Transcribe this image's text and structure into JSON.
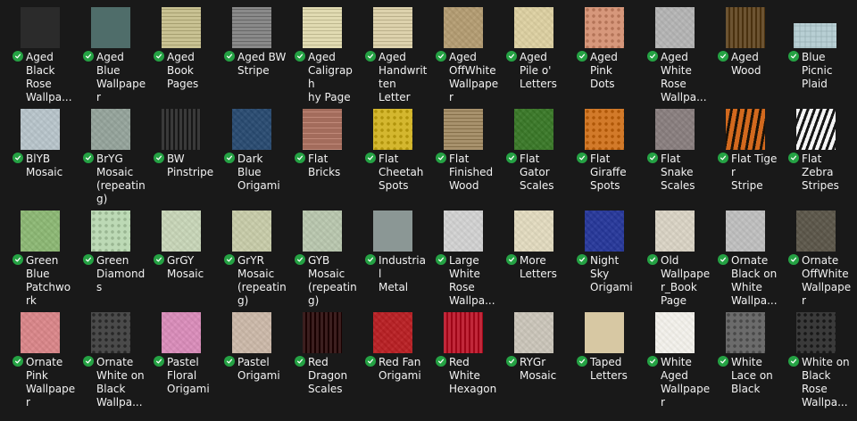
{
  "items": [
    {
      "label": "Aged\nBlack\nRose\nWallpa...",
      "pattern": "dark-grain",
      "color": "#2b2b2b"
    },
    {
      "label": "Aged\nBlue\nWallpape\nr",
      "pattern": "solid",
      "color": "#4f6d6a"
    },
    {
      "label": "Aged\nBook\nPages",
      "pattern": "stripes-h",
      "color": "#c9c293"
    },
    {
      "label": "Aged BW\nStripe",
      "pattern": "stripes-h",
      "color": "#8a8a8a"
    },
    {
      "label": "Aged\nCaligraph\nhy Page",
      "pattern": "stripes-h",
      "color": "#e1dbb2"
    },
    {
      "label": "Aged\nHandwrit\nten\nLetter",
      "pattern": "stripes-h",
      "color": "#ddd2ad"
    },
    {
      "label": "Aged\nOffWhite\nWallpape\nr",
      "pattern": "grain",
      "color": "#b29c74"
    },
    {
      "label": "Aged\nPile o'\nLetters",
      "pattern": "grain",
      "color": "#d9cda1"
    },
    {
      "label": "Aged\nPink\nDots",
      "pattern": "dots",
      "color": "#d6977b"
    },
    {
      "label": "Aged\nWhite\nRose\nWallpa...",
      "pattern": "grain",
      "color": "#b3b3b3"
    },
    {
      "label": "Aged\nWood",
      "pattern": "stripes-v",
      "color": "#6d5432"
    },
    {
      "label": "Blue\nPicnic\nPlaid",
      "pattern": "plaid",
      "color": "#b8cfd4"
    },
    {
      "label": "BlYB\nMosaic",
      "pattern": "grain",
      "color": "#b6c2c8"
    },
    {
      "label": "BrYG\nMosaic\n(repeatin\ng)",
      "pattern": "grain",
      "color": "#95a39b"
    },
    {
      "label": "BW\nPinstripe",
      "pattern": "stripes-v",
      "color": "#3a3a3a"
    },
    {
      "label": "Dark\nBlue\nOrigami",
      "pattern": "grain",
      "color": "#2f4f73"
    },
    {
      "label": "Flat\nBricks",
      "pattern": "bricks",
      "color": "#a36c5c"
    },
    {
      "label": "Flat\nCheetah\nSpots",
      "pattern": "dots",
      "color": "#d4b72f"
    },
    {
      "label": "Flat\nFinished\nWood",
      "pattern": "stripes-h",
      "color": "#a8926d"
    },
    {
      "label": "Flat\nGator\nScales",
      "pattern": "grain",
      "color": "#3f7a2e"
    },
    {
      "label": "Flat\nGiraffe\nSpots",
      "pattern": "dots",
      "color": "#d27a2a"
    },
    {
      "label": "Flat\nSnake\nScales",
      "pattern": "grain",
      "color": "#8a8080"
    },
    {
      "label": "Flat Tiger\nStripe",
      "pattern": "tiger",
      "color": "#d2691e"
    },
    {
      "label": "Flat\nZebra\nStripes",
      "pattern": "zebra",
      "color": "#dcdcdc"
    },
    {
      "label": "Green\nBlue\nPatchwo\nrk",
      "pattern": "grain",
      "color": "#8db676"
    },
    {
      "label": "Green\nDiamonds",
      "pattern": "dots",
      "color": "#bcd9b5"
    },
    {
      "label": "GrGY\nMosaic",
      "pattern": "grain",
      "color": "#c5d2b6"
    },
    {
      "label": "GrYR\nMosaic\n(repeatin\ng)",
      "pattern": "grain",
      "color": "#c5c9a8"
    },
    {
      "label": "GYB\nMosaic\n(repeatin\ng)",
      "pattern": "grain",
      "color": "#b7c4ad"
    },
    {
      "label": "Industrial\nMetal",
      "pattern": "solid",
      "color": "#8b9795"
    },
    {
      "label": "Large\nWhite\nRose\nWallpa...",
      "pattern": "grain",
      "color": "#cfcfcf"
    },
    {
      "label": "More\nLetters",
      "pattern": "grain",
      "color": "#ded7bd"
    },
    {
      "label": "Night\nSky\nOrigami",
      "pattern": "grain",
      "color": "#2d3d9a"
    },
    {
      "label": "Old\nWallpape\nr_Book\nPage",
      "pattern": "grain",
      "color": "#d6d0c2"
    },
    {
      "label": "Ornate\nBlack on\nWhite\nWallpa...",
      "pattern": "grain",
      "color": "#bdbdbd"
    },
    {
      "label": "Ornate\nOffWhite\nWallpape\nr",
      "pattern": "grain",
      "color": "#5f5a4e"
    },
    {
      "label": "Ornate\nPink\nWallpape\nr",
      "pattern": "grain",
      "color": "#d6878a"
    },
    {
      "label": "Ornate\nWhite on\nBlack\nWallpa...",
      "pattern": "dots",
      "color": "#4a4a4a"
    },
    {
      "label": "Pastel\nFloral\nOrigami",
      "pattern": "grain",
      "color": "#d68db8"
    },
    {
      "label": "Pastel\nOrigami",
      "pattern": "grain",
      "color": "#c9b7a8"
    },
    {
      "label": "Red\nDragon\nScales",
      "pattern": "stripes-v",
      "color": "#3c1f1f"
    },
    {
      "label": "Red Fan\nOrigami",
      "pattern": "grain",
      "color": "#b7262a"
    },
    {
      "label": "Red\nWhite\nHexagon",
      "pattern": "stripes-v",
      "color": "#c1283a"
    },
    {
      "label": "RYGr\nMosaic",
      "pattern": "grain",
      "color": "#c8c3b8"
    },
    {
      "label": "Taped\nLetters",
      "pattern": "solid",
      "color": "#d7c8a3"
    },
    {
      "label": "White\nAged\nWallpape\nr",
      "pattern": "grain",
      "color": "#f0eee8"
    },
    {
      "label": "White\nLace on\nBlack",
      "pattern": "dots",
      "color": "#6b6b6b"
    },
    {
      "label": "White on\nBlack\nRose\nWallpa...",
      "pattern": "dots",
      "color": "#3a3a3a"
    }
  ]
}
